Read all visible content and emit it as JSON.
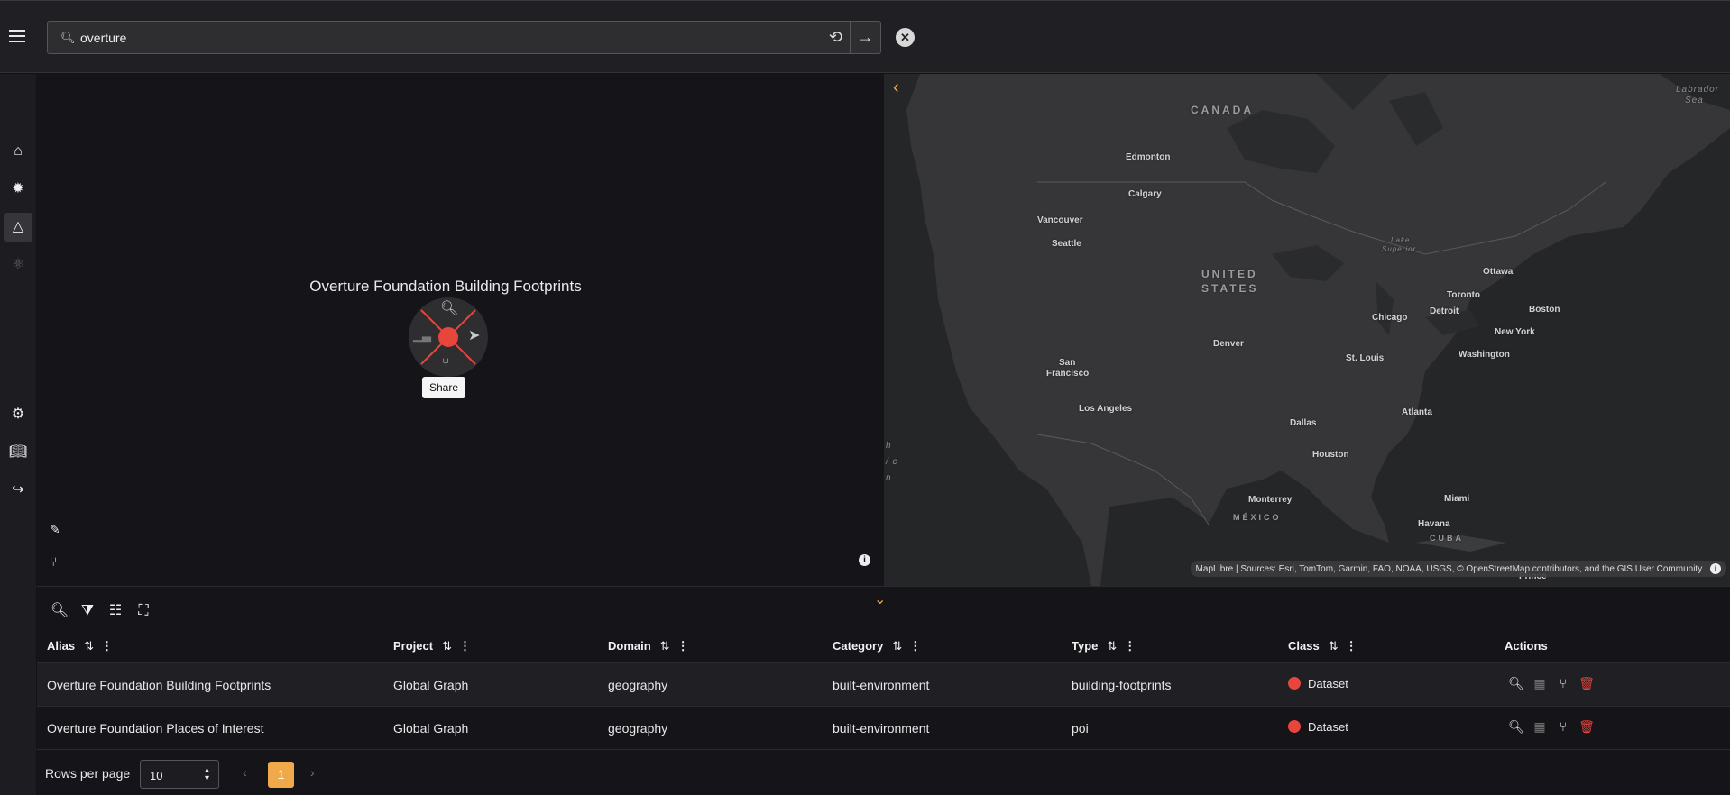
{
  "search": {
    "value": "overture",
    "placeholder": ""
  },
  "nav": {
    "items": [
      {
        "icon": "home-icon"
      },
      {
        "icon": "burst-icon"
      },
      {
        "icon": "graph-icon"
      },
      {
        "icon": "atom-icon"
      },
      {
        "icon": "gear-icon"
      },
      {
        "icon": "book-icon"
      },
      {
        "icon": "logout-icon"
      }
    ]
  },
  "graph": {
    "node_title": "Overture Foundation Building Footprints",
    "tooltip": "Share"
  },
  "map": {
    "labels": {
      "canada": "CANADA",
      "us1": "UNITED",
      "us2": "STATES",
      "mexico": "MÉXICO",
      "cuba": "CUBA",
      "labrador1": "Labrador",
      "labrador2": "Sea",
      "lake_superior1": "Lake",
      "lake_superior2": "Superior",
      "edmonton": "Edmonton",
      "calgary": "Calgary",
      "vancouver": "Vancouver",
      "seattle": "Seattle",
      "ottawa": "Ottawa",
      "toronto": "Toronto",
      "detroit": "Detroit",
      "chicago": "Chicago",
      "boston": "Boston",
      "new_york": "New York",
      "washington": "Washington",
      "denver": "Denver",
      "st_louis": "St. Louis",
      "san_francisco1": "San",
      "san_francisco2": "Francisco",
      "los_angeles": "Los Angeles",
      "dallas": "Dallas",
      "atlanta": "Atlanta",
      "houston": "Houston",
      "monterrey": "Monterrey",
      "miami": "Miami",
      "havana": "Havana",
      "prince": "Prince",
      "pacific1": "h",
      "pacific2": "/ c",
      "pacific3": "n"
    },
    "attribution_lib": "MapLibre",
    "attribution_sources": "Sources: Esri, TomTom, Garmin, FAO, NOAA, USGS, © OpenStreetMap contributors, and the GIS User Community"
  },
  "table": {
    "columns": [
      "Alias",
      "Project",
      "Domain",
      "Category",
      "Type",
      "Class",
      "Actions"
    ],
    "rows": [
      {
        "alias": "Overture Foundation Building Footprints",
        "project": "Global Graph",
        "domain": "geography",
        "category": "built-environment",
        "type": "building-footprints",
        "class": "Dataset"
      },
      {
        "alias": "Overture Foundation Places of Interest",
        "project": "Global Graph",
        "domain": "geography",
        "category": "built-environment",
        "type": "poi",
        "class": "Dataset"
      }
    ],
    "rows_per_page_label": "Rows per page",
    "rows_per_page": "10",
    "page": "1"
  },
  "colors": {
    "accent": "#f0a94a",
    "node": "#e8453c",
    "delete": "#e8453c"
  }
}
